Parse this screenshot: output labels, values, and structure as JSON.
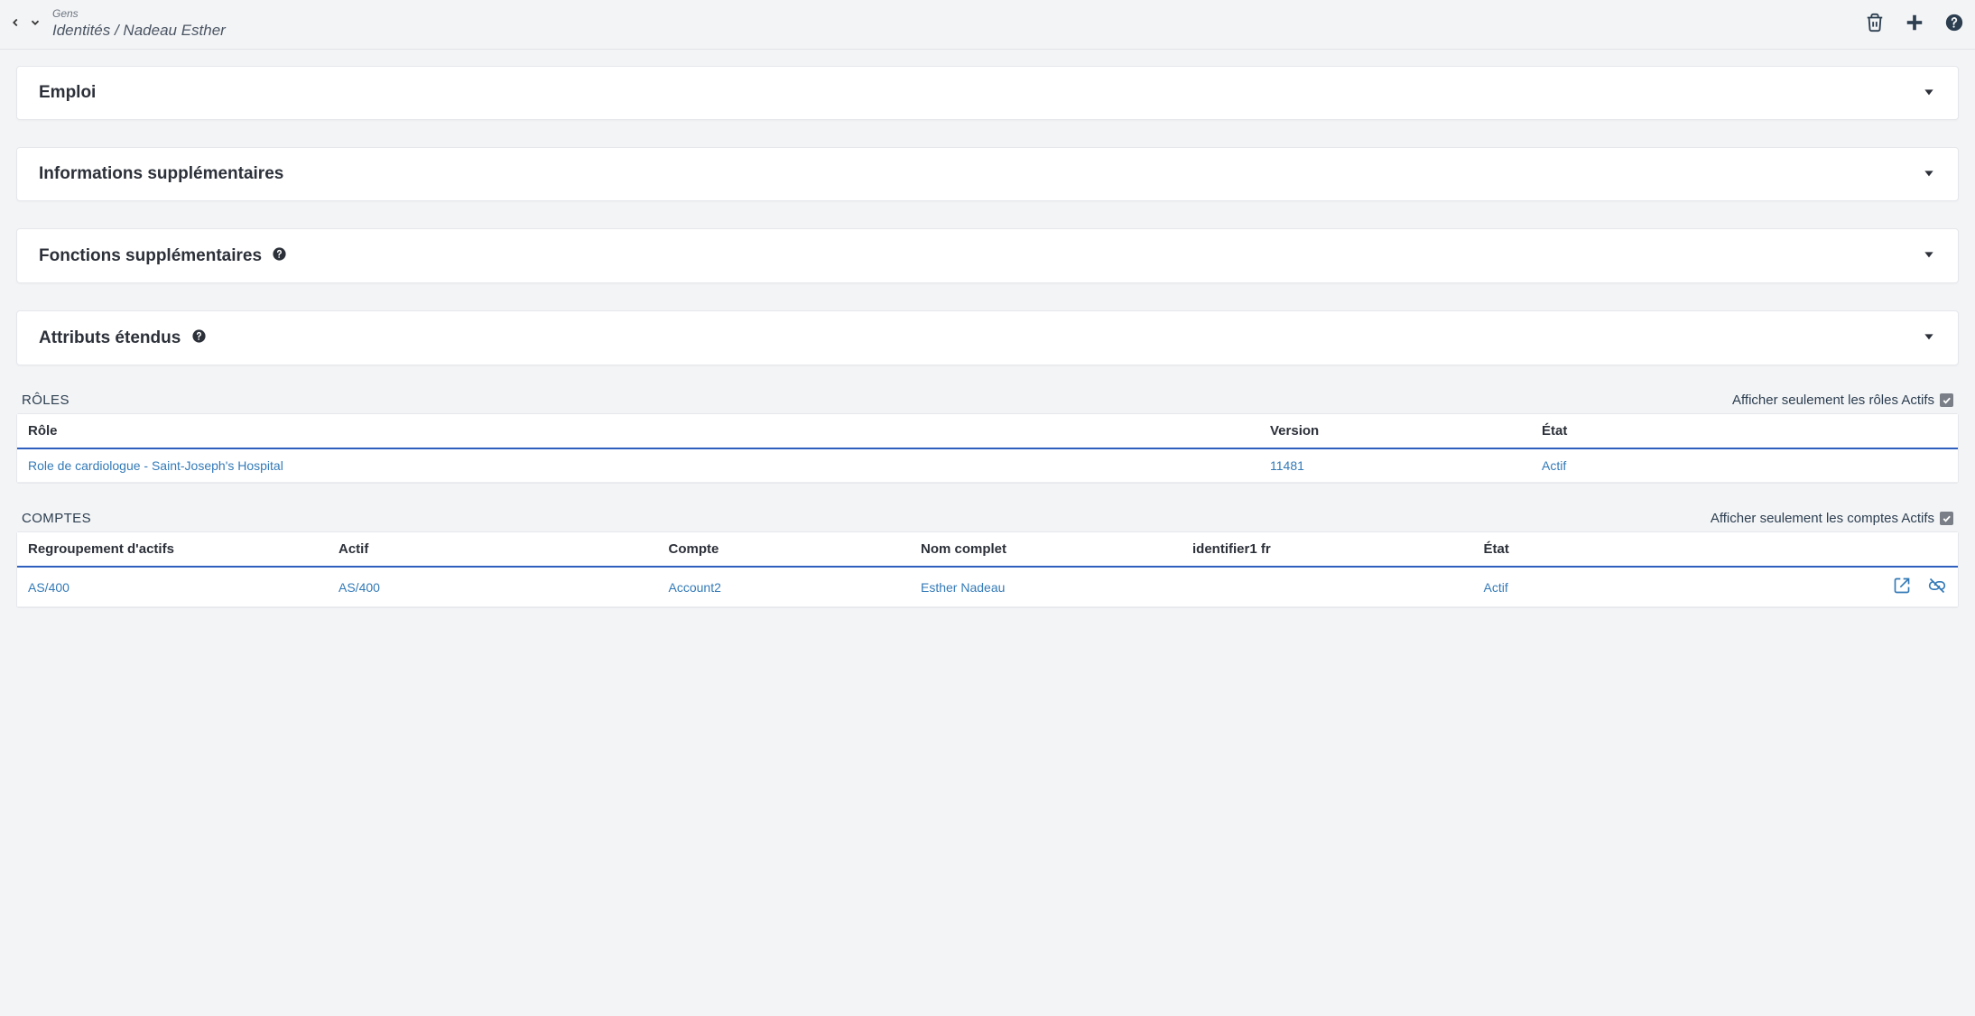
{
  "header": {
    "category": "Gens",
    "breadcrumb": "Identités / Nadeau Esther"
  },
  "panels": {
    "emploi": "Emploi",
    "infos": "Informations supplémentaires",
    "fonctions": "Fonctions supplémentaires",
    "attributs": "Attributs étendus"
  },
  "roles": {
    "title": "RÔLES",
    "filter_label": "Afficher seulement les rôles Actifs",
    "columns": {
      "role": "Rôle",
      "version": "Version",
      "etat": "État"
    },
    "rows": [
      {
        "role": "Role de cardiologue - Saint-Joseph's Hospital",
        "version": "11481",
        "etat": "Actif"
      }
    ]
  },
  "comptes": {
    "title": "COMPTES",
    "filter_label": "Afficher seulement les comptes Actifs",
    "columns": {
      "group": "Regroupement d'actifs",
      "actif": "Actif",
      "compte": "Compte",
      "nom": "Nom complet",
      "ident": "identifier1 fr",
      "etat": "État"
    },
    "rows": [
      {
        "group": "AS/400",
        "actif": "AS/400",
        "compte": "Account2",
        "nom": "Esther Nadeau",
        "ident": "",
        "etat": "Actif"
      }
    ]
  }
}
